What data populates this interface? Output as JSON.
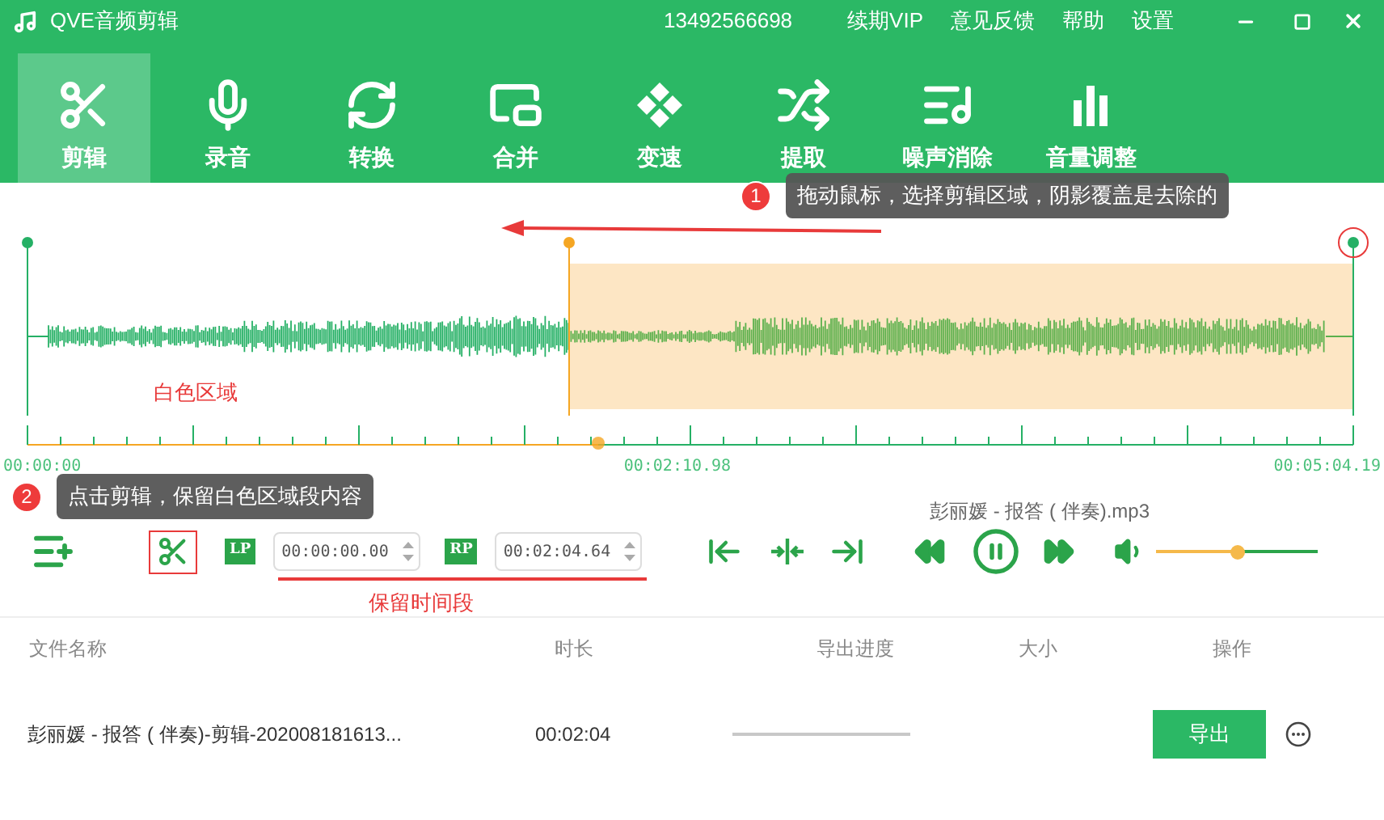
{
  "app": {
    "title": "QVE音频剪辑",
    "phone": "13492566698",
    "menu": [
      "续期VIP",
      "意见反馈",
      "帮助",
      "设置"
    ]
  },
  "tools": [
    {
      "label": "剪辑",
      "kind": "scissors",
      "selected": true
    },
    {
      "label": "录音",
      "kind": "mic",
      "selected": false
    },
    {
      "label": "转换",
      "kind": "convert",
      "selected": false
    },
    {
      "label": "合并",
      "kind": "merge",
      "selected": false
    },
    {
      "label": "变速",
      "kind": "speed",
      "selected": false
    },
    {
      "label": "提取",
      "kind": "shuffle",
      "selected": false
    },
    {
      "label": "噪声消除",
      "kind": "noise",
      "selected": false
    },
    {
      "label": "音量调整",
      "kind": "volume",
      "selected": false
    }
  ],
  "tips": [
    {
      "number": "1",
      "text": "拖动鼠标，选择剪辑区域，阴影覆盖是去除的"
    },
    {
      "number": "2",
      "text": "点击剪辑，保留白色区域段内容"
    }
  ],
  "editor": {
    "region_label": "白色区域",
    "times": [
      "00:00:00",
      "00:02:10.98",
      "00:05:04.19"
    ],
    "file_name": "彭丽媛 - 报答 ( 伴奏).mp3"
  },
  "controls": {
    "lp": "LP",
    "start": "00:00:00.00",
    "rp": "RP",
    "end": "00:02:04.64",
    "keep_label": "保留时间段",
    "volume": {
      "level": 0.5
    }
  },
  "table": {
    "columns": [
      "文件名称",
      "时长",
      "导出进度",
      "大小",
      "操作"
    ],
    "rows": [
      {
        "name": "彭丽媛 - 报答 ( 伴奏)-剪辑-202008181613...",
        "duration": "00:02:04",
        "progress": {
          "level": 0
        },
        "action": "导出"
      }
    ]
  }
}
